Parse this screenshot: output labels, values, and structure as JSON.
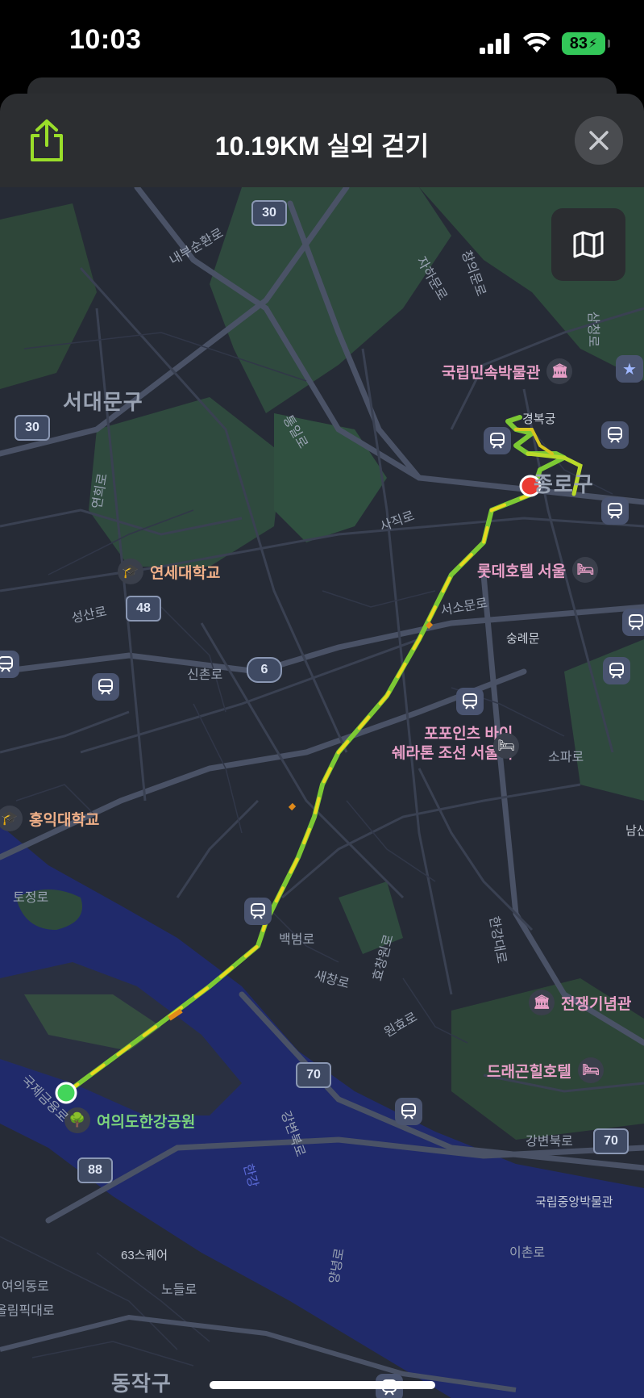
{
  "status": {
    "time": "10:03",
    "battery": "83"
  },
  "header": {
    "title": "10.19KM 실외 걷기"
  },
  "icons": {
    "share": "share-icon",
    "close": "close-icon",
    "map_mode": "map-icon"
  },
  "colors": {
    "accent_green": "#9ade2a",
    "route_yellow": "#e9d81f",
    "route_green": "#7cc934",
    "start": "#43d55a",
    "end": "#ea3a32"
  },
  "map": {
    "districts": {
      "seodaemun": "서대문구",
      "jongno": "종로구",
      "dongjak": "동작구"
    },
    "pois": {
      "folk_museum": "국립민속박물관",
      "gyeongbokgung": "경복궁",
      "yonsei": "연세대학교",
      "lotte_hotel": "롯데호텔 서울",
      "sungnyemun": "숭례문",
      "four_points_1": "포포인츠 바이",
      "four_points_2": "쉐라톤 조선 서울역",
      "hongik": "홍익대학교",
      "war_memorial": "전쟁기념관",
      "dragon_hill": "드래곤힐호텔",
      "yeouido_park": "여의도한강공원",
      "national_museum": "국립중앙박물관",
      "sixty_three": "63스퀘어",
      "somedaegyo": "남산"
    },
    "roads": {
      "naebu": "내부순환로",
      "jaha": "자하문로",
      "changui": "창의문로",
      "samcheong": "삼청로",
      "tongil": "통일로",
      "sajik": "사직로",
      "yeonhui": "연희로",
      "seongsan": "성산로",
      "sinchon": "신촌로",
      "seoso": "서소문로",
      "sopa": "소파로",
      "tojeong": "토정로",
      "baekbeom": "백범로",
      "saechang": "새창로",
      "hyochang": "효창원로",
      "wonhyo": "원효로",
      "hangang": "한강대로",
      "gangbyeon": "강변북로",
      "gangbyeon2": "강변북로",
      "gukjegeumyung": "국제금융로",
      "yeouidong": "여의동로",
      "olympic": "올림픽대로",
      "nodeul": "노들로",
      "ichon": "이촌로",
      "yanghwa": "양녕로",
      "river": "한강"
    },
    "shields": {
      "r30a": "30",
      "r30b": "30",
      "r48": "48",
      "r6": "6",
      "r70a": "70",
      "r70b": "70",
      "r88": "88"
    }
  }
}
